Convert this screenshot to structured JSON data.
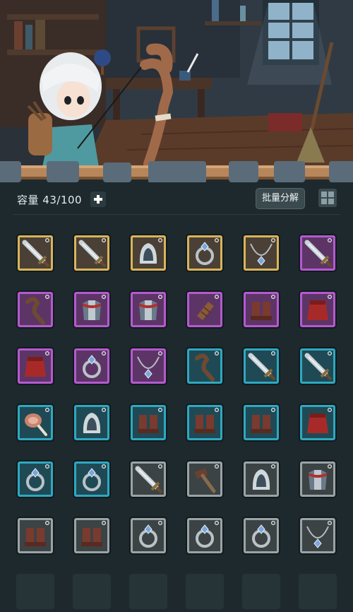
{
  "header": {
    "capacity_label": "容量",
    "capacity_value": "43/100",
    "batch_button_label": "批量分解"
  },
  "icons": {
    "add": "plus-icon",
    "layout": "grid-view-icon"
  },
  "rarity_colors": {
    "gold": {
      "border": "#d9b45a",
      "bg": "#4a4036"
    },
    "purple": {
      "border": "#b45ad0",
      "bg": "#5c3566"
    },
    "blue": {
      "border": "#2fa8c0",
      "bg": "#1f4a55"
    },
    "gray": {
      "border": "#9aa3a6",
      "bg": "#3c4345"
    }
  },
  "inventory": [
    [
      {
        "item": "sword",
        "rarity": "gold"
      },
      {
        "item": "sword",
        "rarity": "gold"
      },
      {
        "item": "hood",
        "rarity": "gold"
      },
      {
        "item": "ring",
        "rarity": "gold"
      },
      {
        "item": "necklace",
        "rarity": "gold"
      },
      {
        "item": "sword",
        "rarity": "purple"
      }
    ],
    [
      {
        "item": "staff",
        "rarity": "purple"
      },
      {
        "item": "armor",
        "rarity": "purple"
      },
      {
        "item": "armor",
        "rarity": "purple"
      },
      {
        "item": "bracer",
        "rarity": "purple"
      },
      {
        "item": "boots",
        "rarity": "purple"
      },
      {
        "item": "cloak",
        "rarity": "purple"
      }
    ],
    [
      {
        "item": "cloak",
        "rarity": "purple"
      },
      {
        "item": "ring",
        "rarity": "purple"
      },
      {
        "item": "necklace",
        "rarity": "purple"
      },
      {
        "item": "staff",
        "rarity": "blue"
      },
      {
        "item": "sword",
        "rarity": "blue"
      },
      {
        "item": "sword",
        "rarity": "blue"
      }
    ],
    [
      {
        "item": "meat",
        "rarity": "blue"
      },
      {
        "item": "hood",
        "rarity": "blue"
      },
      {
        "item": "boots",
        "rarity": "blue"
      },
      {
        "item": "boots",
        "rarity": "blue"
      },
      {
        "item": "boots",
        "rarity": "blue"
      },
      {
        "item": "cloak",
        "rarity": "blue"
      }
    ],
    [
      {
        "item": "ring",
        "rarity": "blue"
      },
      {
        "item": "ring",
        "rarity": "blue"
      },
      {
        "item": "sword",
        "rarity": "gray"
      },
      {
        "item": "hammer",
        "rarity": "gray"
      },
      {
        "item": "hood",
        "rarity": "gray"
      },
      {
        "item": "armor",
        "rarity": "gray"
      }
    ],
    [
      {
        "item": "boots",
        "rarity": "gray"
      },
      {
        "item": "boots",
        "rarity": "gray"
      },
      {
        "item": "ring",
        "rarity": "gray"
      },
      {
        "item": "ring",
        "rarity": "gray"
      },
      {
        "item": "ring",
        "rarity": "gray"
      },
      {
        "item": "necklace",
        "rarity": "gray"
      }
    ]
  ],
  "empty_slots": 6
}
